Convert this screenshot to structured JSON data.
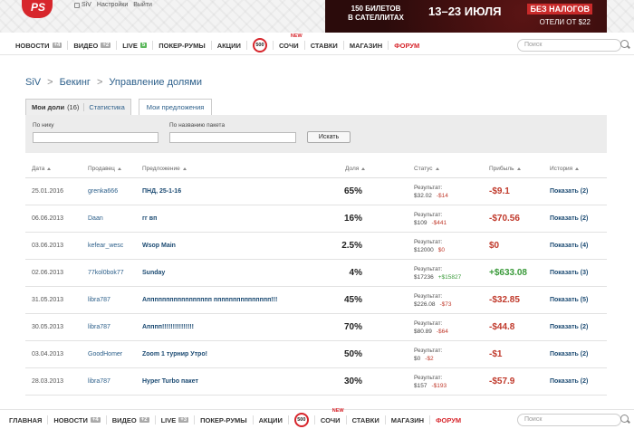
{
  "top": {
    "logo_text": "PS",
    "user_name": "SiV",
    "settings_link": "Настройки",
    "logout_link": "Выйти"
  },
  "banner": {
    "line1": "150 БИЛЕТОВ",
    "line2": "В САТЕЛЛИТАХ",
    "dates": "13–23 ИЮЛЯ",
    "tag": "БЕЗ НАЛОГОВ",
    "hotel": "ОТЕЛИ ОТ $22"
  },
  "nav": {
    "items": [
      {
        "label": "Новости",
        "badge": "+4"
      },
      {
        "label": "Видео",
        "badge": "+2"
      },
      {
        "label": "Live",
        "badge": "5"
      },
      {
        "label": "Покер-румы"
      },
      {
        "label": "Акции"
      },
      {
        "label": "500"
      },
      {
        "label": "Сочи",
        "new": "NEW"
      },
      {
        "label": "Ставки"
      },
      {
        "label": "Магазин"
      },
      {
        "label": "Форум"
      }
    ],
    "search_placeholder": "Поиск"
  },
  "bottom_nav": {
    "items": [
      {
        "label": "Главная"
      },
      {
        "label": "Новости",
        "badge": "+4"
      },
      {
        "label": "Видео",
        "badge": "+2"
      },
      {
        "label": "Live",
        "badge": "+3"
      },
      {
        "label": "Покер-румы"
      },
      {
        "label": "Акции"
      },
      {
        "label": "500"
      },
      {
        "label": "Сочи",
        "new": "NEW"
      },
      {
        "label": "Ставки"
      },
      {
        "label": "Магазин"
      },
      {
        "label": "Форум"
      }
    ],
    "search_placeholder": "Поиск"
  },
  "breadcrumb": [
    "SiV",
    ">",
    "Бекинг",
    ">",
    "Управление долями"
  ],
  "tabs": {
    "my_shares": "Мои доли",
    "my_shares_count": "(16)",
    "stats": "Статистика",
    "my_offers": "Мои предложения"
  },
  "filter": {
    "nick_label": "По нику",
    "package_label": "По названию пакета",
    "search_button": "Искать"
  },
  "table": {
    "headers": {
      "date": "Дата",
      "seller": "Продавец",
      "offer": "Предложение",
      "share": "Доля",
      "status": "Статус",
      "profit": "Прибыль",
      "history": "История"
    },
    "status_label": "Результат:",
    "rows": [
      {
        "date": "25.01.2016",
        "seller": "grenka666",
        "offer": "ПНД, 25-1-16",
        "share": "65%",
        "amount": "$32.02",
        "delta": "-$14",
        "profit": "-$9.1",
        "history": "Показать (2)"
      },
      {
        "date": "06.06.2013",
        "seller": "Daan",
        "offer": "гг вп",
        "share": "16%",
        "amount": "$109",
        "delta": "-$441",
        "profit": "-$70.56",
        "history": "Показать (2)"
      },
      {
        "date": "03.06.2013",
        "seller": "kefear_wesc",
        "offer": "Wsop Main",
        "share": "2.5%",
        "amount": "$12000",
        "delta": "$0",
        "profit": "$0",
        "history": "Показать (4)"
      },
      {
        "date": "02.06.2013",
        "seller": "77kol0bok77",
        "offer": "Sunday",
        "share": "4%",
        "amount": "$17236",
        "delta": "+$15827",
        "profit": "+$633.08",
        "history": "Показать (3)"
      },
      {
        "date": "31.05.2013",
        "seller": "libra787",
        "offer": "Аппппппппппппппппп ппппппппппппппп!!!",
        "share": "45%",
        "amount": "$226.08",
        "delta": "-$73",
        "profit": "-$32.85",
        "history": "Показать (5)"
      },
      {
        "date": "30.05.2013",
        "seller": "libra787",
        "offer": "Апппп!!!!!!!!!!!!!!!",
        "share": "70%",
        "amount": "$80.89",
        "delta": "-$64",
        "profit": "-$44.8",
        "history": "Показать (2)"
      },
      {
        "date": "03.04.2013",
        "seller": "GoodHomer",
        "offer": "Zoom 1 турнир Утро!",
        "share": "50%",
        "amount": "$0",
        "delta": "-$2",
        "profit": "-$1",
        "history": "Показать (2)"
      },
      {
        "date": "28.03.2013",
        "seller": "libra787",
        "offer": "Hyper Turbo пакет",
        "share": "30%",
        "amount": "$157",
        "delta": "-$193",
        "profit": "-$57.9",
        "history": "Показать (2)"
      }
    ]
  },
  "colors": {
    "accent_red": "#d7262c",
    "link_blue": "#2c5f8a",
    "loss": "#c0392b",
    "gain": "#3a9a3a"
  }
}
